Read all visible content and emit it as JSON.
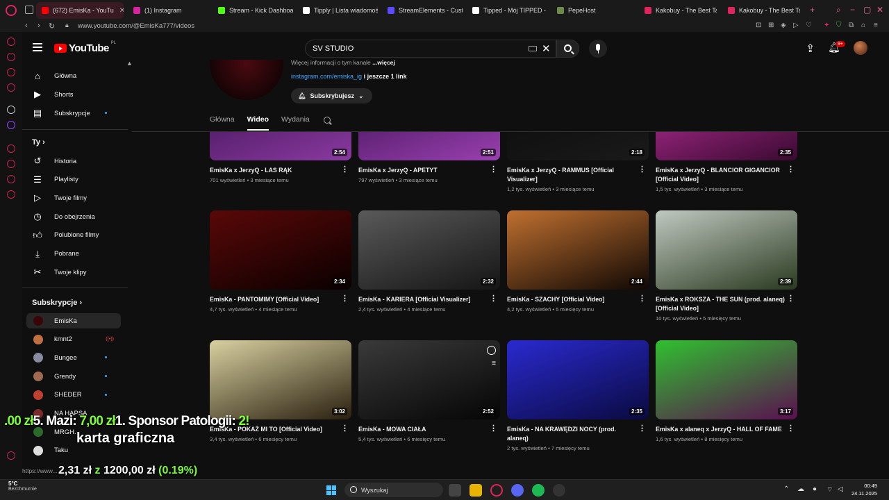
{
  "browser": {
    "tabs": [
      {
        "label": "(672) EmisKa - YouTu",
        "active": true,
        "favicon_color": "#ff0000"
      },
      {
        "label": "(1) Instagram",
        "favicon_color": "#d6249f"
      },
      {
        "label": "Stream - Kick Dashboa",
        "favicon_color": "#53fc18"
      },
      {
        "label": "Tipply | Lista wiadomości",
        "favicon_color": "#ffffff"
      },
      {
        "label": "StreamElements - Custo",
        "favicon_color": "#5a4bff"
      },
      {
        "label": "Tipped - Mój TIPPED - T",
        "favicon_color": "#ffffff"
      },
      {
        "label": "PepeHost",
        "favicon_color": "#6e8a4a"
      },
      {
        "label": "Kakobuy - The Best Ta",
        "favicon_color": "#e0245e"
      },
      {
        "label": "Kakobuy - The Best Tac",
        "favicon_color": "#e0245e"
      }
    ],
    "new_tab": "+",
    "url": "www.youtube.com/@EmisKa777/videos",
    "status_url": "https://www..."
  },
  "header": {
    "logo_text": "YouTube",
    "country_code": "PL",
    "search_value": "SV STUDIO",
    "notifications_badge": "9+"
  },
  "sidebar": {
    "main": [
      {
        "label": "Główna",
        "icon": "home-icon"
      },
      {
        "label": "Shorts",
        "icon": "shorts-icon"
      },
      {
        "label": "Subskrypcje",
        "icon": "subscriptions-icon"
      }
    ],
    "you_header": "Ty",
    "you": [
      {
        "label": "Historia",
        "icon": "history-icon"
      },
      {
        "label": "Playlisty",
        "icon": "playlists-icon"
      },
      {
        "label": "Twoje filmy",
        "icon": "your-videos-icon"
      },
      {
        "label": "Do obejrzenia",
        "icon": "watch-later-icon"
      },
      {
        "label": "Polubione filmy",
        "icon": "liked-icon"
      },
      {
        "label": "Pobrane",
        "icon": "downloads-icon"
      },
      {
        "label": "Twoje klipy",
        "icon": "clips-icon"
      }
    ],
    "subs_header": "Subskrypcje",
    "subs": [
      {
        "label": "EmisKa",
        "color": "#3a0508"
      },
      {
        "label": "kmnt2",
        "color": "#c07040"
      },
      {
        "label": "Bungee",
        "color": "#8a8aa0"
      },
      {
        "label": "Grendy",
        "color": "#a06a50"
      },
      {
        "label": "SHEDER",
        "color": "#c04030"
      },
      {
        "label": "NA HAPSA",
        "color": "#7a2a2a"
      },
      {
        "label": "MRGH.",
        "color": "#2a6a2a"
      },
      {
        "label": "Taku",
        "color": "#dddddd"
      }
    ]
  },
  "channel": {
    "more_info": "Więcej informacji o tym kanale",
    "more_label": "...więcej",
    "link": "instagram.com/emiska_ig",
    "link_suffix": "i jeszcze 1 link",
    "subscribe_label": "Subskrybujesz",
    "tabs": [
      "Główna",
      "Wideo",
      "Wydania"
    ]
  },
  "videos": [
    {
      "title": "EmisKa x JerzyQ - LAS RĄK",
      "views": "701 wyświetleń",
      "age": "3 miesiące temu",
      "duration": "2:54",
      "thumb": [
        "#3a1050",
        "#8a3aa0"
      ]
    },
    {
      "title": "EmisKa x JerzyQ - APETYT",
      "views": "797 wyświetleń",
      "age": "3 miesiące temu",
      "duration": "2:51",
      "thumb": [
        "#3a1050",
        "#9a40b0"
      ]
    },
    {
      "title": "EmisKa x JerzyQ - RAMMUS [Official Visualizer]",
      "views": "1,2 tys. wyświetleń",
      "age": "3 miesiące temu",
      "duration": "2:18",
      "thumb": [
        "#0a0a0a",
        "#1a1a1a"
      ]
    },
    {
      "title": "EmisKa x JerzyQ - BLANCIOR GIGANCIOR [Official Video]",
      "views": "1,5 tys. wyświetleń",
      "age": "3 miesiące temu",
      "duration": "2:35",
      "thumb": [
        "#c030a0",
        "#3a0a30"
      ]
    },
    {
      "title": "EmisKa - PANTOMIMY [Official Video]",
      "views": "4,7 tys. wyświetleń",
      "age": "4 miesiące temu",
      "duration": "2:34",
      "thumb": [
        "#5a0808",
        "#0a0000"
      ]
    },
    {
      "title": "EmisKa - KARIERA [Official Visualizer]",
      "views": "2,4 tys. wyświetleń",
      "age": "4 miesiące temu",
      "duration": "2:32",
      "thumb": [
        "#5a5a5a",
        "#151515"
      ]
    },
    {
      "title": "EmisKa - SZACHY [Official Video]",
      "views": "4,2 tys. wyświetleń",
      "age": "5 miesięcy temu",
      "duration": "2:44",
      "thumb": [
        "#c07030",
        "#100804"
      ]
    },
    {
      "title": "EmisKa x ROKSZA - THE SUN (prod. alaneq) [Official Video]",
      "views": "10 tys. wyświetleń",
      "age": "5 miesięcy temu",
      "duration": "2:39",
      "thumb": [
        "#c0c8c0",
        "#2a3a20"
      ]
    },
    {
      "title": "EmisKa - POKAŻ MI TO [Official Video]",
      "views": "3,4 tys. wyświetleń",
      "age": "6 miesięcy temu",
      "duration": "3:02",
      "thumb": [
        "#d8d0a0",
        "#2a2010"
      ]
    },
    {
      "title": "EmisKa - MOWA CIAŁA",
      "views": "5,4 tys. wyświetleń",
      "age": "6 miesięcy temu",
      "duration": "2:52",
      "thumb": [
        "#3a3a3a",
        "#050505"
      ]
    },
    {
      "title": "EmisKa - NA KRAWĘDZI NOCY (prod. alaneq)",
      "views": "2 tys. wyświetleń",
      "age": "7 miesięcy temu",
      "duration": "2:35",
      "thumb": [
        "#2a2ad0",
        "#0a0a40"
      ]
    },
    {
      "title": "EmisKa x alaneq x JerzyQ - HALL OF FAME",
      "views": "1,6 tys. wyświetleń",
      "age": "8 miesięcy temu",
      "duration": "3:17",
      "thumb": [
        "#30c030",
        "#5a1050"
      ]
    }
  ],
  "overlay": {
    "ticker_a_amount": ".00 zł",
    "ticker_b_name": "5. Mazi:",
    "ticker_b_amount": "7,00 zł",
    "ticker_c_name": "1. Sponsor Patologii:",
    "ticker_c_amount": "2!",
    "goal_title": "karta graficzna",
    "goal_progress": "2,31 zł",
    "goal_sep": "z",
    "goal_target": "1200,00 zł",
    "goal_percent": "(0.19%)"
  },
  "taskbar": {
    "weather_temp": "5°C",
    "weather_desc": "Bezchmurnie",
    "search_placeholder": "Wyszukaj",
    "time": "00:49",
    "date": "24.11.2025"
  }
}
